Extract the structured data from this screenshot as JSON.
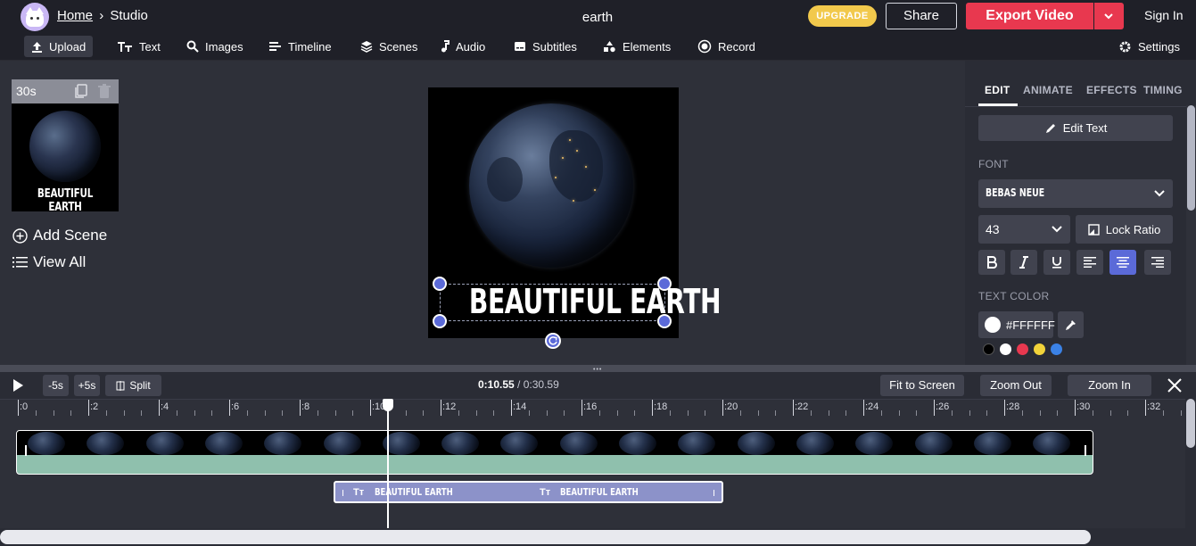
{
  "header": {
    "breadcrumb_home": "Home",
    "breadcrumb_sep": "›",
    "breadcrumb_current": "Studio",
    "project_title": "earth",
    "upgrade_label": "UPGRADE",
    "share_label": "Share",
    "export_label": "Export Video",
    "signin_label": "Sign In"
  },
  "toolbar": {
    "items": [
      {
        "label": "Upload",
        "icon": "upload-icon"
      },
      {
        "label": "Text",
        "icon": "text-icon"
      },
      {
        "label": "Images",
        "icon": "search-icon"
      },
      {
        "label": "Timeline",
        "icon": "timeline-icon"
      },
      {
        "label": "Scenes",
        "icon": "layers-icon"
      },
      {
        "label": "Audio",
        "icon": "music-note-icon"
      },
      {
        "label": "Subtitles",
        "icon": "subtitles-icon"
      },
      {
        "label": "Elements",
        "icon": "shapes-icon"
      },
      {
        "label": "Record",
        "icon": "record-icon"
      }
    ],
    "settings_label": "Settings"
  },
  "scenes": {
    "duration": "30s",
    "thumb_caption": "BEAUTIFUL EARTH",
    "add_scene_label": "Add Scene",
    "view_all_label": "View All"
  },
  "canvas": {
    "text": "BEAUTIFUL EARTH"
  },
  "right_panel": {
    "tabs": [
      "EDIT",
      "ANIMATE",
      "EFFECTS",
      "TIMING"
    ],
    "active_tab": "EDIT",
    "edit_text_label": "Edit Text",
    "font_section": "FONT",
    "font_value": "BEBAS NEUE",
    "size_value": "43",
    "lock_ratio_label": "Lock Ratio",
    "format_buttons": [
      "B",
      "I",
      "U",
      "align-left",
      "align-center",
      "align-right"
    ],
    "active_align": "align-center",
    "text_color_section": "TEXT COLOR",
    "text_color_value": "#FFFFFF",
    "swatches": [
      "#000000",
      "#ffffff",
      "#e8384f",
      "#f2d33a",
      "#3b82e6"
    ]
  },
  "timeline": {
    "back_label": "-5s",
    "forward_label": "+5s",
    "split_label": "Split",
    "current_time": "0:10.55",
    "time_sep": " / ",
    "total_time": "0:30.59",
    "fit_label": "Fit to Screen",
    "zoom_out_label": "Zoom Out",
    "zoom_in_label": "Zoom In",
    "ruler_labels": [
      ":0",
      ":2",
      ":4",
      ":6",
      ":8",
      ":10",
      ":12",
      ":14",
      ":16",
      ":18",
      ":20",
      ":22",
      ":24",
      ":26",
      ":28",
      ":30",
      ":32"
    ],
    "text_clip_label_1": "BEAUTIFUL EARTH",
    "text_clip_label_2": "BEAUTIFUL EARTH"
  }
}
